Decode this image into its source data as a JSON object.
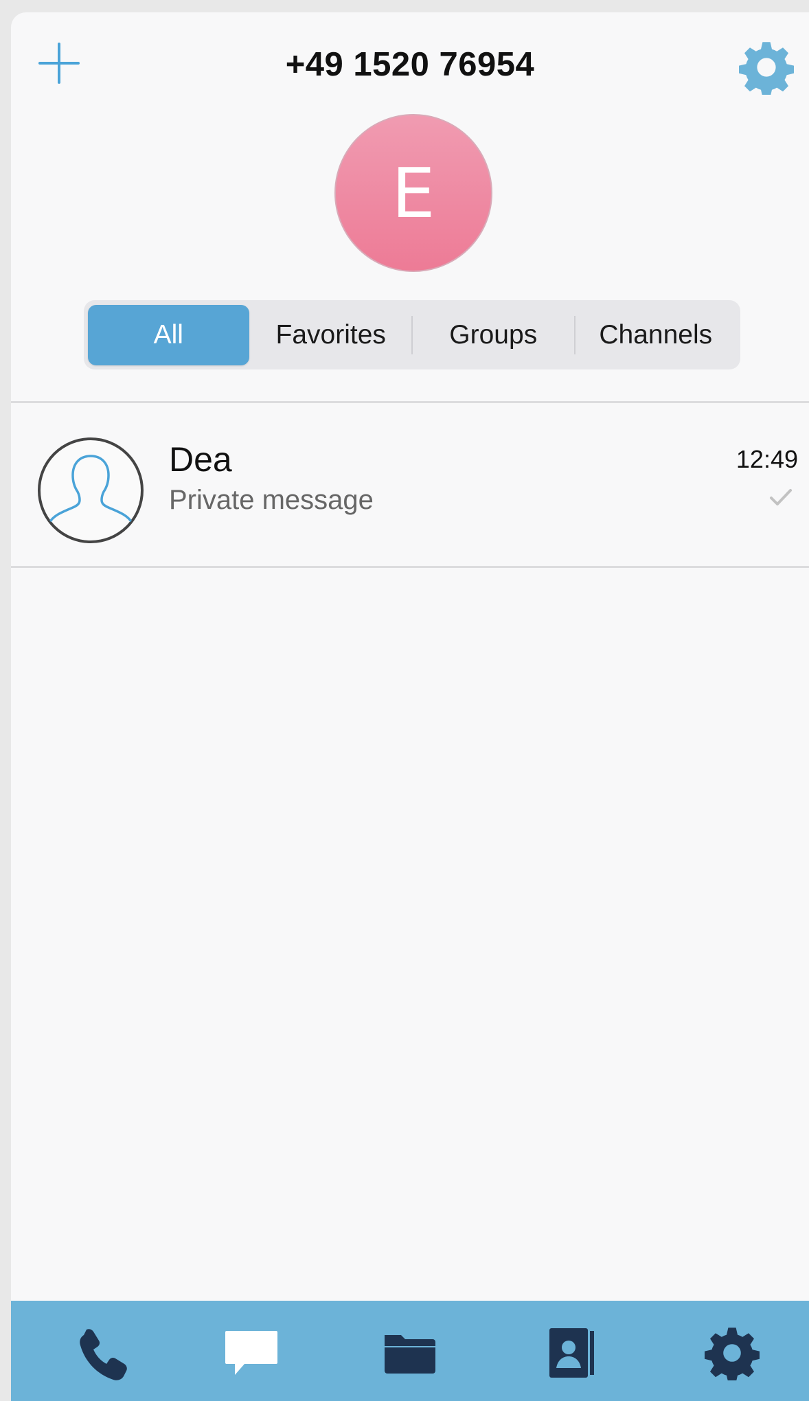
{
  "header": {
    "title": "+49 1520 76954",
    "add_icon": "plus-icon",
    "settings_icon": "gear-icon"
  },
  "profile": {
    "initial": "E",
    "color": "#ee879f"
  },
  "segments": {
    "items": [
      "All",
      "Favorites",
      "Groups",
      "Channels"
    ],
    "selected": "All"
  },
  "chats": [
    {
      "name": "Dea",
      "preview": "Private message",
      "time": "12:49",
      "status_icon": "checkmark-icon",
      "avatar_icon": "person-silhouette-icon"
    }
  ],
  "tabbar": {
    "icons": [
      "phone-icon",
      "chat-bubble-icon",
      "folder-icon",
      "contacts-book-icon",
      "gear-icon"
    ],
    "background": "#6cb3d8",
    "icon_color": "#1e3350"
  },
  "accent_color": "#57a5d5"
}
